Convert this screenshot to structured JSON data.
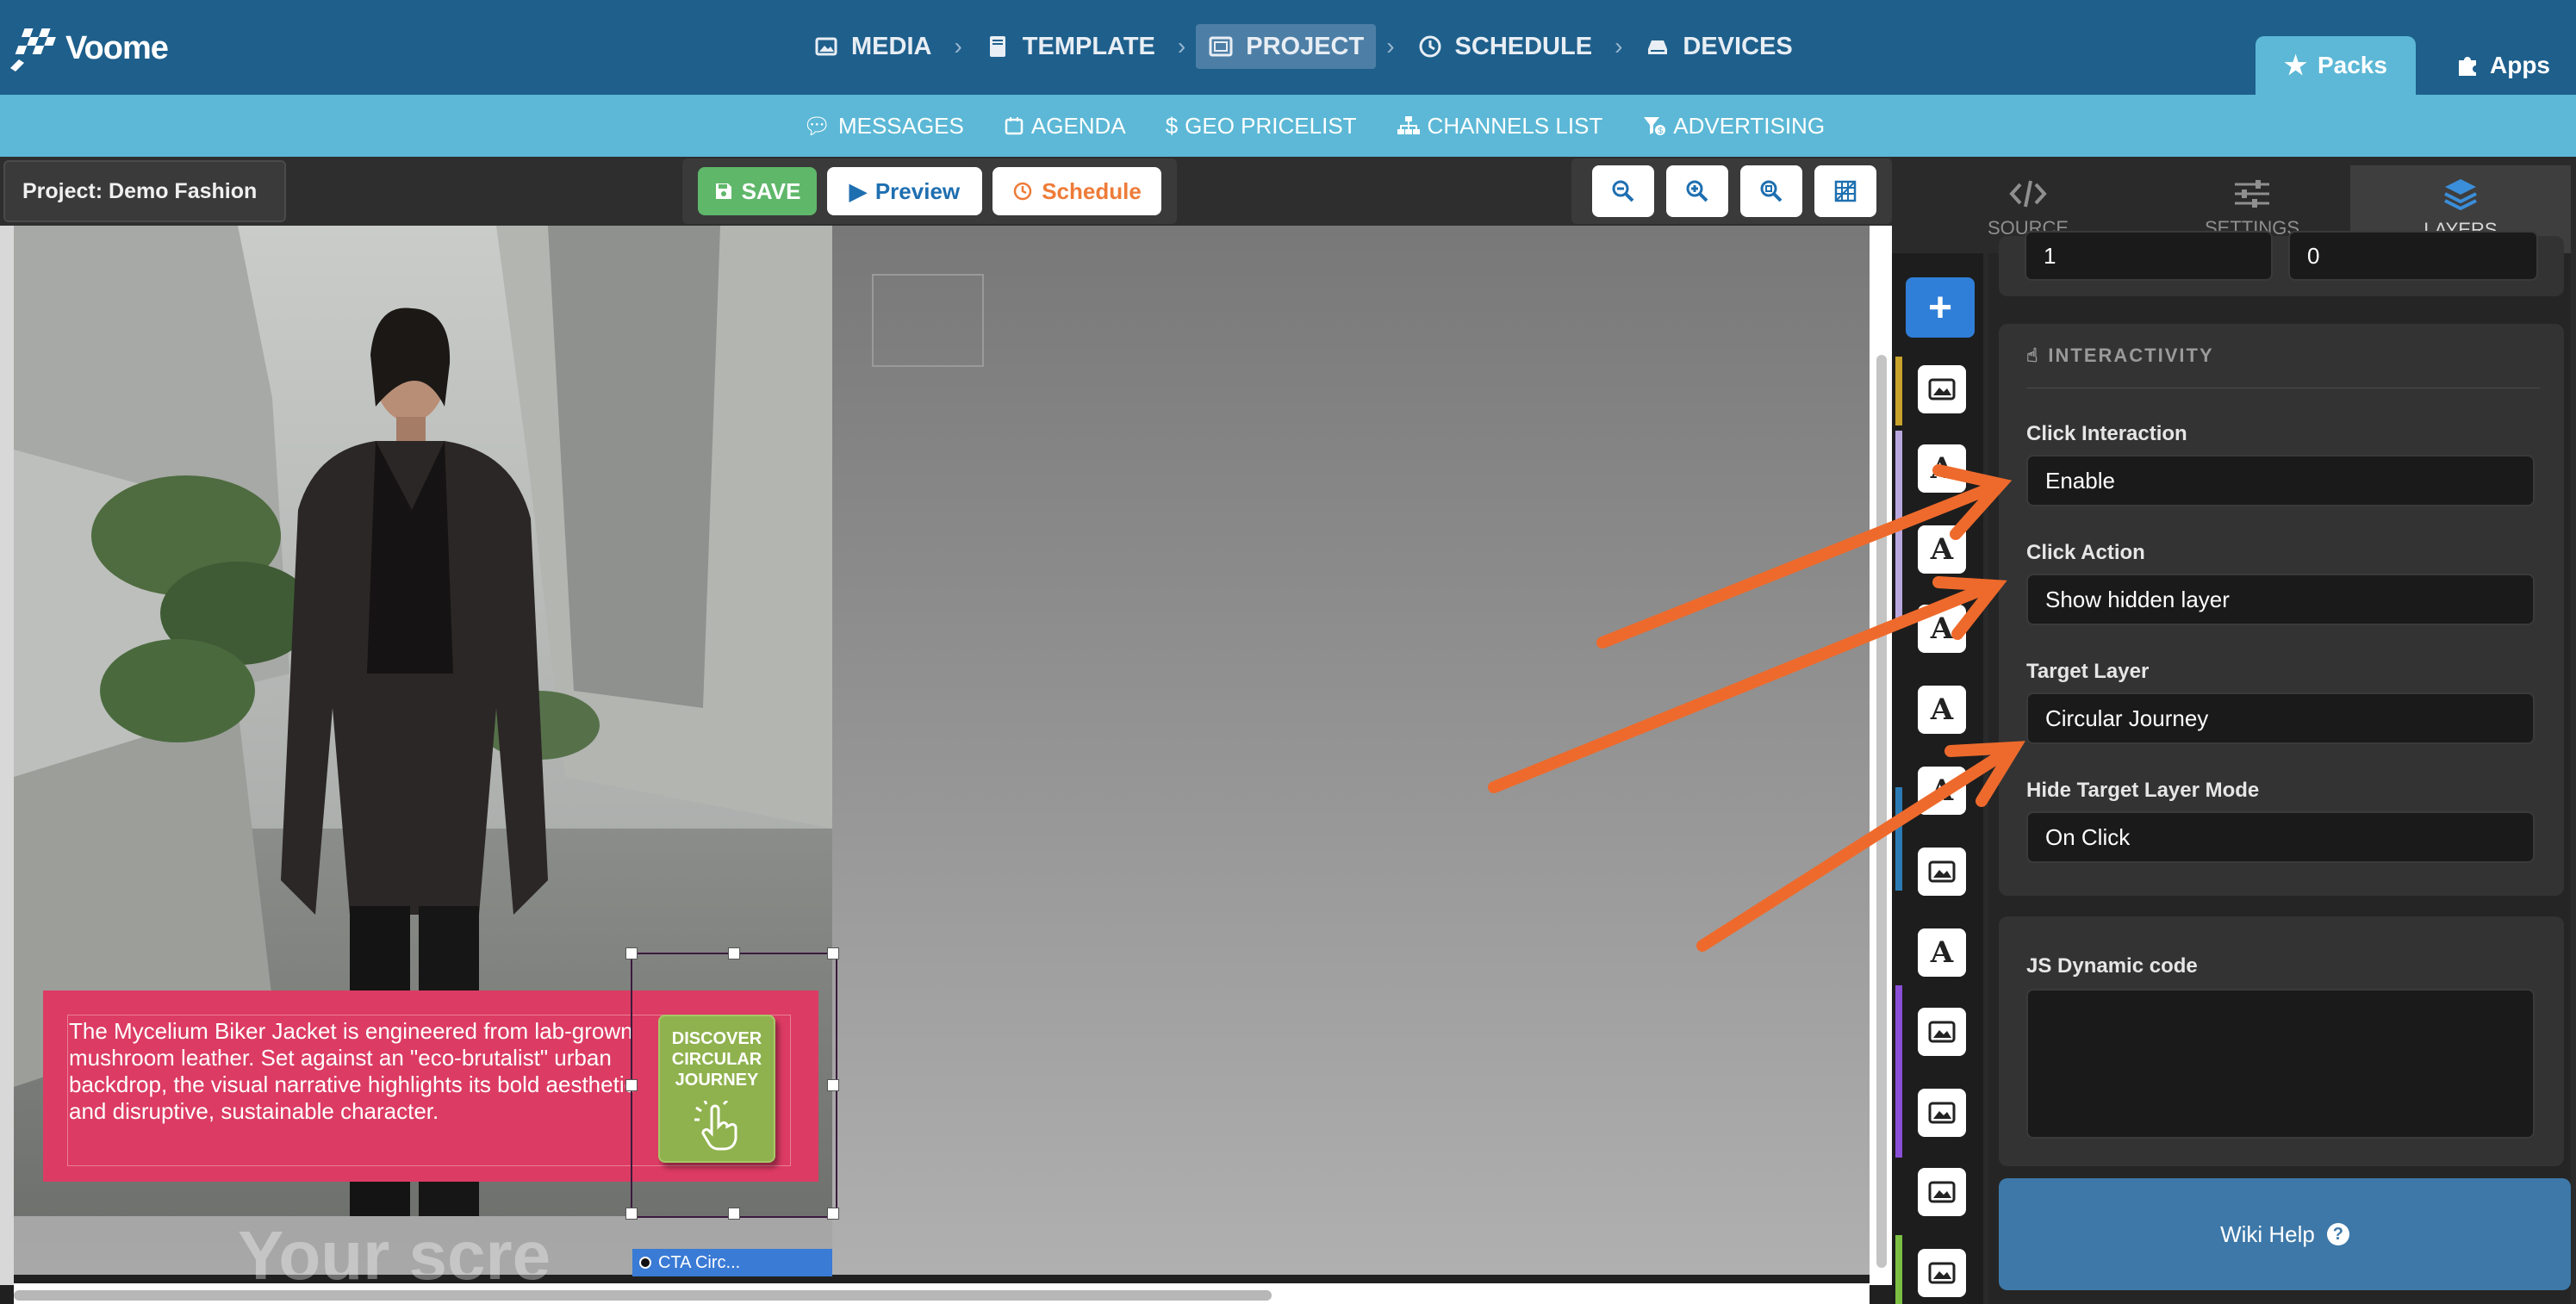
{
  "brand": {
    "name": "Voome"
  },
  "main_nav": [
    {
      "label": "MEDIA",
      "icon": "image-icon",
      "active": false
    },
    {
      "label": "TEMPLATE",
      "icon": "book-icon",
      "active": false
    },
    {
      "label": "PROJECT",
      "icon": "project-icon",
      "active": true
    },
    {
      "label": "SCHEDULE",
      "icon": "clock-icon",
      "active": false
    },
    {
      "label": "DEVICES",
      "icon": "devices-icon",
      "active": false
    }
  ],
  "top_right": {
    "packs": "Packs",
    "apps": "Apps"
  },
  "sub_nav": [
    {
      "label": "MESSAGES",
      "icon": "chat-icon"
    },
    {
      "label": "AGENDA",
      "icon": "calendar-icon"
    },
    {
      "label": "GEO PRICELIST",
      "icon": "dollar-icon"
    },
    {
      "label": "CHANNELS LIST",
      "icon": "sitemap-icon"
    },
    {
      "label": "ADVERTISING",
      "icon": "funnel-dollar-icon"
    }
  ],
  "toolbar": {
    "project_title": "Project: Demo Fashion",
    "save": "SAVE",
    "preview": "Preview",
    "schedule": "Schedule"
  },
  "canvas": {
    "card_text": "The Mycelium Biker Jacket is engineered from lab-grown mushroom leather. Set against an \"eco-brutalist\" urban backdrop, the visual narrative highlights its bold aesthetic and disruptive, sustainable character.",
    "cta_lines": [
      "DISCOVER",
      "CIRCULAR",
      "JOURNEY"
    ],
    "selected_layer_label": "CTA  Circ...",
    "ghost_text": "Your scre"
  },
  "panel": {
    "tabs": [
      {
        "label": "SOURCE",
        "icon": "code-icon",
        "active": false
      },
      {
        "label": "SETTINGS",
        "icon": "sliders-icon",
        "active": false
      },
      {
        "label": "LAYERS",
        "icon": "layers-icon",
        "active": true
      }
    ],
    "top_fields": [
      "1",
      "0"
    ],
    "interactivity": {
      "title": "INTERACTIVITY",
      "click_interaction_label": "Click Interaction",
      "click_interaction_value": "Enable",
      "click_action_label": "Click Action",
      "click_action_value": "Show hidden layer",
      "target_layer_label": "Target Layer",
      "target_layer_value": "Circular Journey",
      "hide_mode_label": "Hide Target Layer Mode",
      "hide_mode_value": "On Click"
    },
    "js_label": "JS Dynamic code",
    "wiki": "Wiki Help"
  },
  "layers": [
    "image",
    "text",
    "text",
    "text",
    "text",
    "text",
    "image",
    "text",
    "image",
    "image",
    "image",
    "image"
  ],
  "colors": {
    "header": "#1e5f8c",
    "subheader": "#5cb8d6",
    "card": "#dc3b63",
    "cta": "#8fb24e",
    "arrow": "#ee6a2c",
    "accent": "#2f7fd8"
  }
}
